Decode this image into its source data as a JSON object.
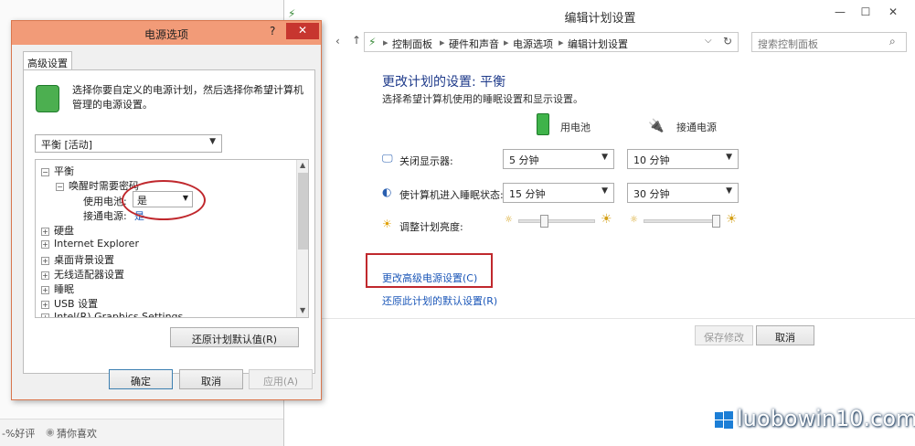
{
  "background": {
    "bottom_left_rating": "-%好评",
    "bottom_left_link": "猜你喜欢"
  },
  "control_panel": {
    "window_title": "编辑计划设置",
    "breadcrumbs": [
      "控制面板",
      "硬件和声音",
      "电源选项",
      "编辑计划设置"
    ],
    "search_placeholder": "搜索控制面板",
    "heading": "更改计划的设置: 平衡",
    "subheading": "选择希望计算机使用的睡眠设置和显示设置。",
    "col_battery": "用电池",
    "col_plugged": "接通电源",
    "rows": [
      {
        "label": "关闭显示器:",
        "battery": "5 分钟",
        "plugged": "10 分钟"
      },
      {
        "label": "使计算机进入睡眠状态:",
        "battery": "15 分钟",
        "plugged": "30 分钟"
      }
    ],
    "brightness_label": "调整计划亮度:",
    "brightness_battery": 0.35,
    "brightness_plugged": 0.95,
    "link_advanced": "更改高级电源设置(C)",
    "link_restore": "还原此计划的默认设置(R)",
    "save_button": "保存修改",
    "cancel_button": "取消"
  },
  "dialog": {
    "title": "电源选项",
    "help": "?",
    "close": "✕",
    "tab": "高级设置",
    "description": "选择你要自定义的电源计划，然后选择你希望计算机管理的电源设置。",
    "plan": "平衡 [活动]",
    "tree": {
      "root": "平衡",
      "wake_password": "唤醒时需要密码",
      "on_battery_label": "使用电池:",
      "on_battery_value": "是",
      "plugged_label": "接通电源:",
      "plugged_value": "是",
      "items": [
        "硬盘",
        "Internet Explorer",
        "桌面背景设置",
        "无线适配器设置",
        "睡眠",
        "USB 设置",
        "Intel(R) Graphics Settings"
      ]
    },
    "restore_button": "还原计划默认值(R)",
    "ok_button": "确定",
    "cancel_button": "取消",
    "apply_button": "应用(A)"
  },
  "watermark": "luobowin10.com",
  "colors": {
    "accent_red": "#c0282d",
    "dialog_title": "#f29b78",
    "link_blue": "#1a56b8"
  }
}
